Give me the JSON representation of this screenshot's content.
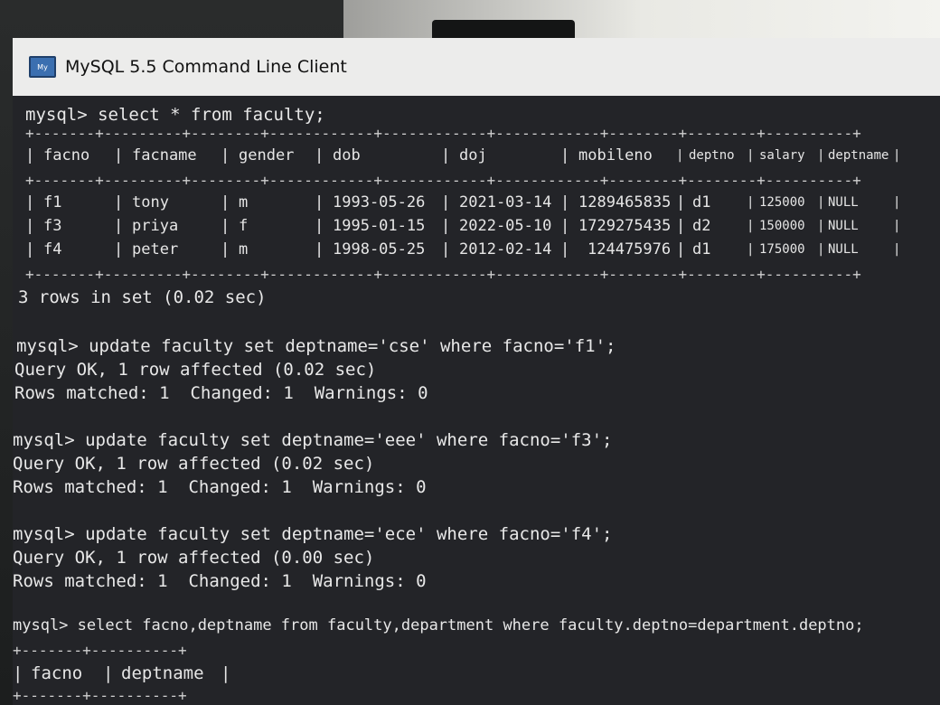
{
  "window": {
    "title": "MySQL 5.5 Command Line Client"
  },
  "console": {
    "lines": [
      {
        "text": "mysql> select * from faculty;"
      },
      {
        "text": "3 rows in set (0.02 sec)"
      },
      {
        "text": "mysql> update faculty set deptname='cse' where facno='f1';"
      },
      {
        "text": "Query OK, 1 row affected (0.02 sec)"
      },
      {
        "text": "Rows matched: 1  Changed: 1  Warnings: 0"
      },
      {
        "text": "mysql> update faculty set deptname='eee' where facno='f3';"
      },
      {
        "text": "Query OK, 1 row affected (0.02 sec)"
      },
      {
        "text": "Rows matched: 1  Changed: 1  Warnings: 0"
      },
      {
        "text": "mysql> update faculty set deptname='ece' where facno='f4';"
      },
      {
        "text": "Query OK, 1 row affected (0.00 sec)"
      },
      {
        "text": "Rows matched: 1  Changed: 1  Warnings: 0"
      },
      {
        "text": "mysql> select facno,deptname from faculty,department where faculty.deptno=department.deptno;"
      }
    ],
    "faculty_table": {
      "columns": [
        "facno",
        "facname",
        "gender",
        "dob",
        "doj",
        "mobileno",
        "deptno",
        "salary",
        "deptname"
      ],
      "rows": [
        [
          "f1",
          "tony",
          "m",
          "1993-05-26",
          "2021-03-14",
          "1289465835",
          "d1",
          "125000",
          "NULL"
        ],
        [
          "f3",
          "priya",
          "f",
          "1995-01-15",
          "2022-05-10",
          "1729275435",
          "d2",
          "150000",
          "NULL"
        ],
        [
          "f4",
          "peter",
          "m",
          "1998-05-25",
          "2012-02-14",
          "124475976",
          "d1",
          "175000",
          "NULL"
        ]
      ]
    },
    "result_table": {
      "columns": [
        "facno",
        "deptname"
      ]
    }
  },
  "colors": {
    "console_bg": "#232428",
    "console_text": "#e8e8e8",
    "titlebar_bg": "#ececeb"
  }
}
